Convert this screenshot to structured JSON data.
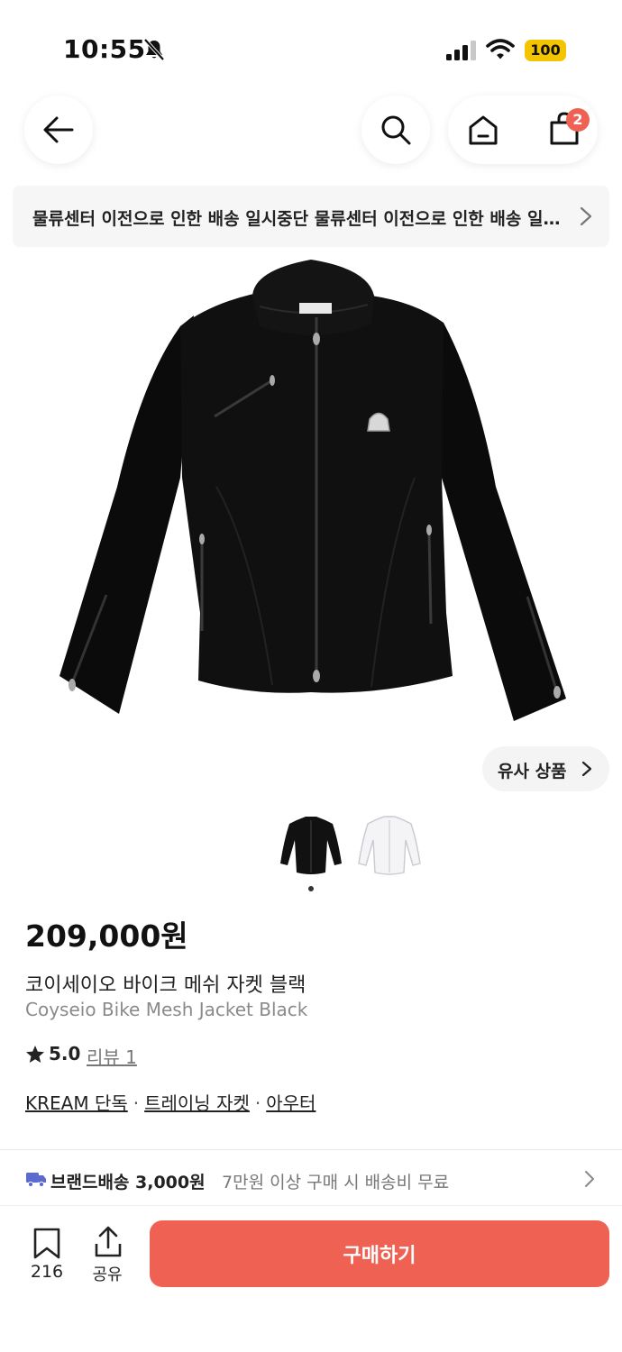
{
  "status_bar": {
    "time": "10:55",
    "battery": "100"
  },
  "nav": {
    "cart_badge": "2",
    "icons": [
      "back-arrow-icon",
      "search-icon",
      "home-icon",
      "shopping-bag-icon"
    ]
  },
  "notice": {
    "text": "물류센터 이전으로 인한 배송 일시중단 물류센터 이전으로 인한 배송 일시중단"
  },
  "similar_button": {
    "label": "유사 상품"
  },
  "gallery": {
    "thumbnails": [
      "black",
      "white"
    ],
    "current_index": 1
  },
  "product": {
    "price": "209,000원",
    "name_ko": "코이세이오 바이크 메쉬 자켓 블랙",
    "name_en": "Coyseio Bike Mesh Jacket Black",
    "rating": "5.0",
    "review_label": "리뷰 1",
    "categories": [
      "KREAM 단독",
      "트레이닝 자켓",
      "아우터"
    ],
    "category_separator": "·"
  },
  "delivery": {
    "label": "브랜드배송 3,000원",
    "note": "7만원 이상 구매 시 배송비 무료"
  },
  "bottom_bar": {
    "bookmark_count": "216",
    "share_label": "공유",
    "buy_label": "구매하기"
  },
  "colors": {
    "accent": "#ef6253",
    "battery": "#f5c400",
    "delivery_truck": "#5b6ad0"
  }
}
